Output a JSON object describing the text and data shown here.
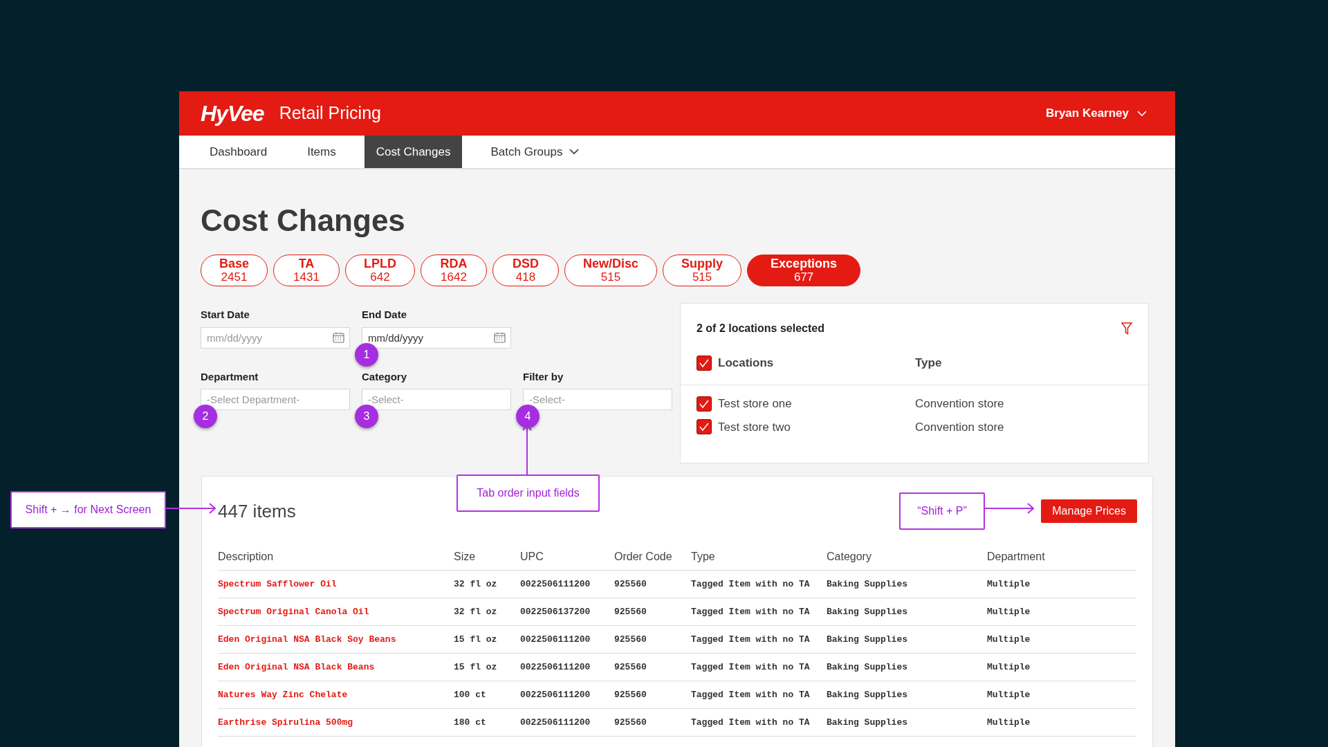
{
  "header": {
    "logo": "HyVee",
    "app_title": "Retail Pricing",
    "user": "Bryan Kearney"
  },
  "nav": [
    {
      "label": "Dashboard",
      "selected": false,
      "kind": "link"
    },
    {
      "label": "Items",
      "selected": false,
      "kind": "link"
    },
    {
      "label": "Cost Changes",
      "selected": true,
      "kind": "link"
    },
    {
      "label": "Batch Groups",
      "selected": false,
      "kind": "dropdown"
    }
  ],
  "page_title": "Cost Changes",
  "pills": [
    {
      "label": "Base",
      "count": "2451",
      "selected": false
    },
    {
      "label": "TA",
      "count": "1431",
      "selected": false
    },
    {
      "label": "LPLD",
      "count": "642",
      "selected": false
    },
    {
      "label": "RDA",
      "count": "1642",
      "selected": false
    },
    {
      "label": "DSD",
      "count": "418",
      "selected": false
    },
    {
      "label": "New/Disc",
      "count": "515",
      "selected": false
    },
    {
      "label": "Supply",
      "count": "515",
      "selected": false
    },
    {
      "label": "Exceptions",
      "count": "677",
      "selected": true
    }
  ],
  "filter_rows": [
    [
      {
        "label": "Start Date",
        "placeholder": "mm/dd/yyyy",
        "kind": "date"
      },
      {
        "label": "End Date",
        "value": "mm/dd/yyyy",
        "kind": "date",
        "tab_order": "1"
      }
    ],
    [
      {
        "label": "Department",
        "placeholder": "-Select Department-",
        "kind": "select",
        "tab_order": "2"
      },
      {
        "label": "Category",
        "placeholder": "-Select-",
        "kind": "select",
        "tab_order": "3"
      },
      {
        "label": "Filter by",
        "placeholder": "-Select-",
        "kind": "select",
        "tab_order": "4"
      }
    ]
  ],
  "locations": {
    "summary": "2 of 2 locations selected",
    "all_checked": true,
    "columns": [
      "Locations",
      "Type"
    ],
    "rows": [
      {
        "name": "Test store one",
        "type": "Convention store",
        "checked": true
      },
      {
        "name": "Test store two",
        "type": "Convention store",
        "checked": true
      }
    ]
  },
  "items": {
    "count": "447 items",
    "button": "Manage Prices",
    "columns": [
      "Description",
      "Size",
      "UPC",
      "Order Code",
      "Type",
      "Category",
      "Department"
    ],
    "rows": [
      [
        "Spectrum Safflower Oil",
        "32 fl oz",
        "0022506111200",
        "925560",
        "Tagged Item with no TA",
        "Baking Supplies",
        "Multiple"
      ],
      [
        "Spectrum Original Canola Oil",
        "32 fl oz",
        "0022506137200",
        "925560",
        "Tagged Item with no TA",
        "Baking Supplies",
        "Multiple"
      ],
      [
        "Eden Original NSA Black Soy Beans",
        "15 fl oz",
        "0022506111200",
        "925560",
        "Tagged Item with no TA",
        "Baking Supplies",
        "Multiple"
      ],
      [
        "Eden Original NSA Black Beans",
        "15 fl oz",
        "0022506111200",
        "925560",
        "Tagged Item with no TA",
        "Baking Supplies",
        "Multiple"
      ],
      [
        "Natures Way Zinc Chelate",
        "100 ct",
        "0022506111200",
        "925560",
        "Tagged Item with no TA",
        "Baking Supplies",
        "Multiple"
      ],
      [
        "Earthrise Spirulina 500mg",
        "180 ct",
        "0022506111200",
        "925560",
        "Tagged Item with no TA",
        "Baking Supplies",
        "Multiple"
      ]
    ]
  },
  "annotations": [
    {
      "kind": "next_screen",
      "text": "Shift + → for Next Screen"
    },
    {
      "kind": "tab_order",
      "text": "Tab order input fields"
    },
    {
      "kind": "shortcut",
      "text": "“Shift + P”"
    }
  ]
}
